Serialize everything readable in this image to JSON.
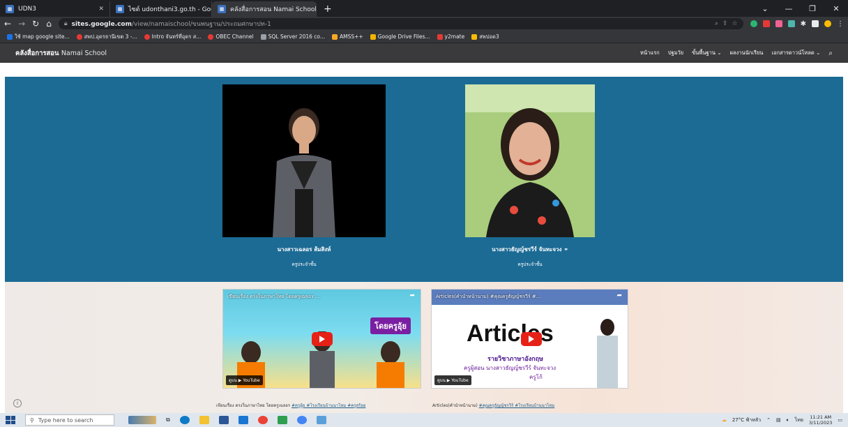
{
  "browser": {
    "tabs": [
      {
        "label": "UDN3",
        "active": false
      },
      {
        "label": "ไซต์ udonthani3.go.th - Google S",
        "active": false
      },
      {
        "label": "คลังสื่อการสอน Namai School - ประ",
        "active": true
      }
    ],
    "url_host": "sites.google.com",
    "url_path": "/view/namaischool/ขนพนฐาน/ประถมศกษาปท-1",
    "bookmarks": [
      "ใช้ map google site...",
      "สพป.อุดรธานีเขต 3 -...",
      "Intro จันทร์ที่อุดร ส...",
      "OBEC Channel",
      "SQL Server 2016 co...",
      "AMSS++",
      "Google Drive Files...",
      "y2mate",
      "สพปอด3"
    ]
  },
  "site": {
    "title_bold": "คลังสื่อการสอน",
    "title_thin": "Namai School",
    "nav": [
      "หน้าแรก",
      "ปฐมวัย",
      "ขั้นพื้นฐาน ⌄",
      "ผลงานนักเรียน",
      "เอกสารดาวน์โหลด ⌄"
    ]
  },
  "teachers": [
    {
      "name": "นางสาวเฉลอร ส้มสิงห์",
      "role": "ครูประจำชั้น",
      "link_icon": false
    },
    {
      "name": "นางสาวธัญญ์ชรวีร์ จันทะจวง",
      "role": "ครูประจำชั้น",
      "link_icon": true
    }
  ],
  "videos": [
    {
      "title": "เขียนเรื่อง ตรงในภาษาไทย โดยครูเฉลอร ...",
      "overlay": "โดยครูอุ้ย",
      "badge": "ดูบน ▶ YouTube",
      "caption_plain": "เขียนเรื่อง ตรงในภาษาไทย โดยครูเฉลอร ",
      "caption_tags": "#ครูอุ้ย #โรงเรียนบ้านนาไหม #ครูสร้อย"
    },
    {
      "title": "Articles(คำนำหน้านาม) #คุณครูธัญญ์ชรวีร์ #...",
      "overlay": "Articles",
      "sub1": "รายวิชาภาษาอังกฤษ",
      "sub2": "ครูผู้สอน นางสาวธัญญ์ชรวีร์ จันทะจวง",
      "sub3": "ครูโก้",
      "badge": "ดูบน ▶ YouTube",
      "caption_plain": "Articles(คำนำหน้านาม) ",
      "caption_tags": "#คุณครูธัญญ์ชรวีร์ #โรงเรียนบ้านนาไหม"
    }
  ],
  "taskbar": {
    "search_placeholder": "Type here to search",
    "weather": "27°C ฟ้าหลัว",
    "lang": "ไทย",
    "time": "11:21 AM",
    "date": "3/11/2023"
  }
}
